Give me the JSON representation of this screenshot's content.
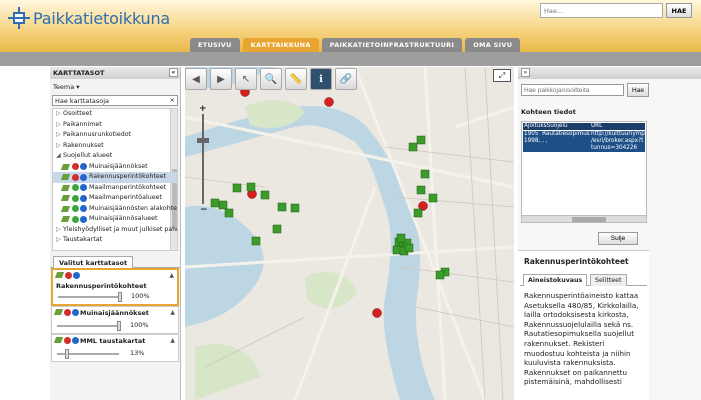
{
  "header": {
    "logo_text": "Paikkatietoikkuna",
    "search_placeholder": "Hae...",
    "search_button": "HAE",
    "tabs": [
      "ETUSIVU",
      "KARTTAIKKUNA",
      "PAIKKATIETOINFRASTRUKTUURI",
      "OMA SIVU"
    ],
    "active_tab": "KARTTAIKKUNA"
  },
  "left": {
    "title": "KARTTATASOT",
    "collapse": "«",
    "teema": "Teema ▾",
    "filter_value": "Hae karttatasoja",
    "filter_clear": "×",
    "tree": [
      {
        "label": "Osoitteet",
        "kind": "group"
      },
      {
        "label": "Paikannimet",
        "kind": "group"
      },
      {
        "label": "Paikannusrunkotiedot",
        "kind": "group"
      },
      {
        "label": "Rakennukset",
        "kind": "group"
      },
      {
        "label": "Suojellut alueet",
        "kind": "open"
      },
      {
        "label": "Muinaisjäännökset",
        "kind": "red"
      },
      {
        "label": "Rakennusperintökohteet",
        "kind": "red",
        "selected": true
      },
      {
        "label": "Maailmanperintökohteet",
        "kind": "green"
      },
      {
        "label": "Maailmanperintöalueet",
        "kind": "green"
      },
      {
        "label": "Muinaisjäännösten alakohte",
        "kind": "green"
      },
      {
        "label": "Muinaisjäännösalueet",
        "kind": "green"
      },
      {
        "label": "Yleishyödylliset ja muut julkiset palvelu",
        "kind": "group"
      },
      {
        "label": "Taustakartat",
        "kind": "group"
      }
    ],
    "selected_tab": "Valitut karttatasot",
    "selected_layers": [
      {
        "name": "Rakennusperintökohteet",
        "opacity": "100%",
        "opacity_value": 100
      },
      {
        "name": "Muinaisjäännökset",
        "opacity": "100%",
        "opacity_value": 100
      },
      {
        "name": "MML taustakartat",
        "opacity": "13%",
        "opacity_value": 13
      }
    ]
  },
  "map": {
    "fullscreen_icon": "⤢",
    "tools": [
      {
        "name": "back-arrow-icon",
        "glyph": "◀"
      },
      {
        "name": "forward-arrow-icon",
        "glyph": "▶"
      },
      {
        "name": "pointer-icon",
        "glyph": "↖"
      },
      {
        "name": "zoom-box-icon",
        "glyph": "🔍"
      },
      {
        "name": "measure-icon",
        "glyph": "📏"
      },
      {
        "name": "info-icon",
        "glyph": "ℹ",
        "active": true
      },
      {
        "name": "link-icon",
        "glyph": "🔗"
      }
    ],
    "zoom_plus": "+",
    "zoom_minus": "−",
    "colors": {
      "red_marker": "#d61f1f",
      "green_marker": "#3c9c2a",
      "water": "#b9d3e0",
      "land": "#ebe7e1"
    }
  },
  "right": {
    "collapse": "»",
    "place_placeholder": "Hae paikkoja/osoitteita",
    "place_button": "Hae",
    "info_title": "Kohteen tiedot",
    "grid_headers": [
      "AjoituksSuojelu",
      "URL"
    ],
    "grid_rows": [
      [
        "1905  Rautatiesopimus",
        "http://kulttuuriymparis"
      ],
      [
        "1998, , ,",
        "/esri/broker.aspx?t"
      ],
      [
        "",
        "tunnus=304226"
      ]
    ],
    "close_button": "Sulje",
    "desc_title": "Rakennusperintökohteet",
    "desc_tabs": [
      "Aineistokuvaus",
      "Selitteet"
    ],
    "desc_lines": [
      "Rakennusperintöaineisto kattaa",
      "Asetuksella 480/85, Kirkkolailla,",
      "lailla ortodoksisesta kirkosta,",
      "Rakennussuojelulailla sekä ns.",
      "Rautatiesopimuksella suojellut",
      "rakennukset. Rekisteri",
      "muodostuu kohteista ja niihin",
      "kuuluvista rakennuksista.",
      "Rakennukset on paikannettu",
      "pistemäisinä, mahdollisesti"
    ]
  }
}
